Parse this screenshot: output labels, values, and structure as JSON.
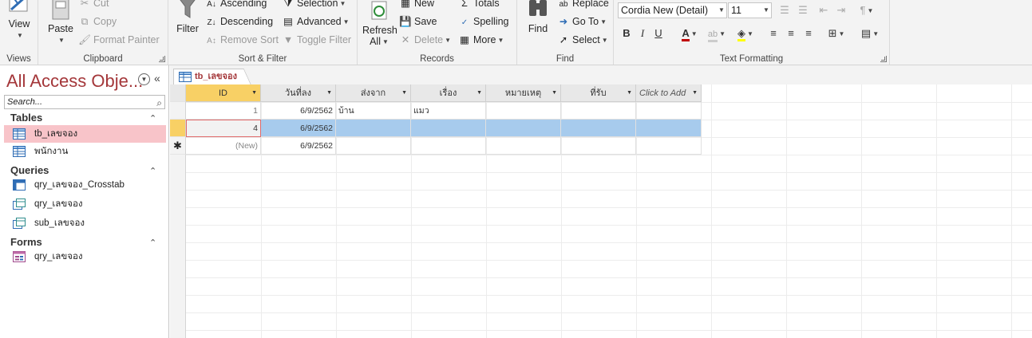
{
  "ribbon": {
    "views": {
      "view_label": "View",
      "group_label": "Views"
    },
    "clipboard": {
      "paste_label": "Paste",
      "cut_label": "Cut",
      "copy_label": "Copy",
      "format_painter_label": "Format Painter",
      "group_label": "Clipboard"
    },
    "sort_filter": {
      "filter_label": "Filter",
      "ascending_label": "Ascending",
      "descending_label": "Descending",
      "remove_sort_label": "Remove Sort",
      "selection_label": "Selection",
      "advanced_label": "Advanced",
      "toggle_filter_label": "Toggle Filter",
      "group_label": "Sort & Filter"
    },
    "records": {
      "refresh_label": "Refresh",
      "refresh_label2": "All",
      "new_label": "New",
      "save_label": "Save",
      "delete_label": "Delete",
      "totals_label": "Totals",
      "spelling_label": "Spelling",
      "more_label": "More",
      "group_label": "Records"
    },
    "find": {
      "find_label": "Find",
      "replace_label": "Replace",
      "goto_label": "Go To",
      "select_label": "Select",
      "group_label": "Find"
    },
    "text_formatting": {
      "font_name": "Cordia New (Detail)",
      "font_size": "11",
      "bold": "B",
      "italic": "I",
      "underline": "U",
      "group_label": "Text Formatting",
      "font_color": "#c00000",
      "highlight_color": "#ffff00"
    }
  },
  "navpane": {
    "title": "All Access Obje...",
    "search_placeholder": "Search...",
    "sections": [
      {
        "label": "Tables",
        "items": [
          "tb_เลขจอง",
          "พนักงาน"
        ]
      },
      {
        "label": "Queries",
        "items": [
          "qry_เลขจอง_Crosstab",
          "qry_เลขจอง",
          "sub_เลขจอง"
        ]
      },
      {
        "label": "Forms",
        "items": [
          "qry_เลขจอง"
        ]
      }
    ],
    "selected_color": "#f8c4c9"
  },
  "document": {
    "tab_label": "tb_เลขจอง",
    "columns": [
      "ID",
      "วันที่ลง",
      "ส่งจาก",
      "เรื่อง",
      "หมายเหตุ",
      "ที่รับ",
      "Click to Add"
    ],
    "rows": [
      [
        "1",
        "6/9/2562",
        "บ้าน",
        "แมว",
        "",
        "",
        ""
      ],
      [
        "4",
        "6/9/2562",
        "",
        "",
        "",
        "",
        ""
      ],
      [
        "(New)",
        "6/9/2562",
        "",
        "",
        "",
        "",
        ""
      ]
    ],
    "active_header_color": "#f8d065",
    "selected_row_color": "#a7cbed"
  }
}
